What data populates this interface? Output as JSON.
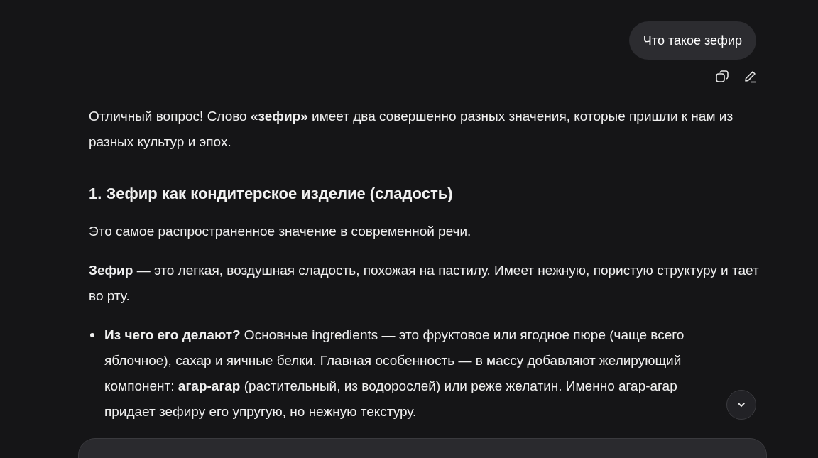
{
  "user_message": {
    "text": "Что такое зефир"
  },
  "answer": {
    "intro": "Отличный вопрос! Слово **«зефир»** имеет два совершенно разных значения, которые пришли к нам из разных культур и эпох.",
    "heading": "1. Зефир как кондитерское изделие (сладость)",
    "paragraphs": [
      "Это самое распространенное значение в современной речи.",
      "**Зефир** — это легкая, воздушная сладость, похожая на пастилу. Имеет нежную, пористую структуру и тает во рту."
    ],
    "bullets": [
      "**Из чего его делают?** Основные ingredients — это фруктовое или ягодное пюре (чаще всего яблочное), сахар и яичные белки. Главная особенность — в массу добавляют желирующий компонент: **агар-агар** (растительный, из водорослей) или реже желатин. Именно агар-агар придает зефиру его упругую, но нежную текстуру."
    ]
  }
}
